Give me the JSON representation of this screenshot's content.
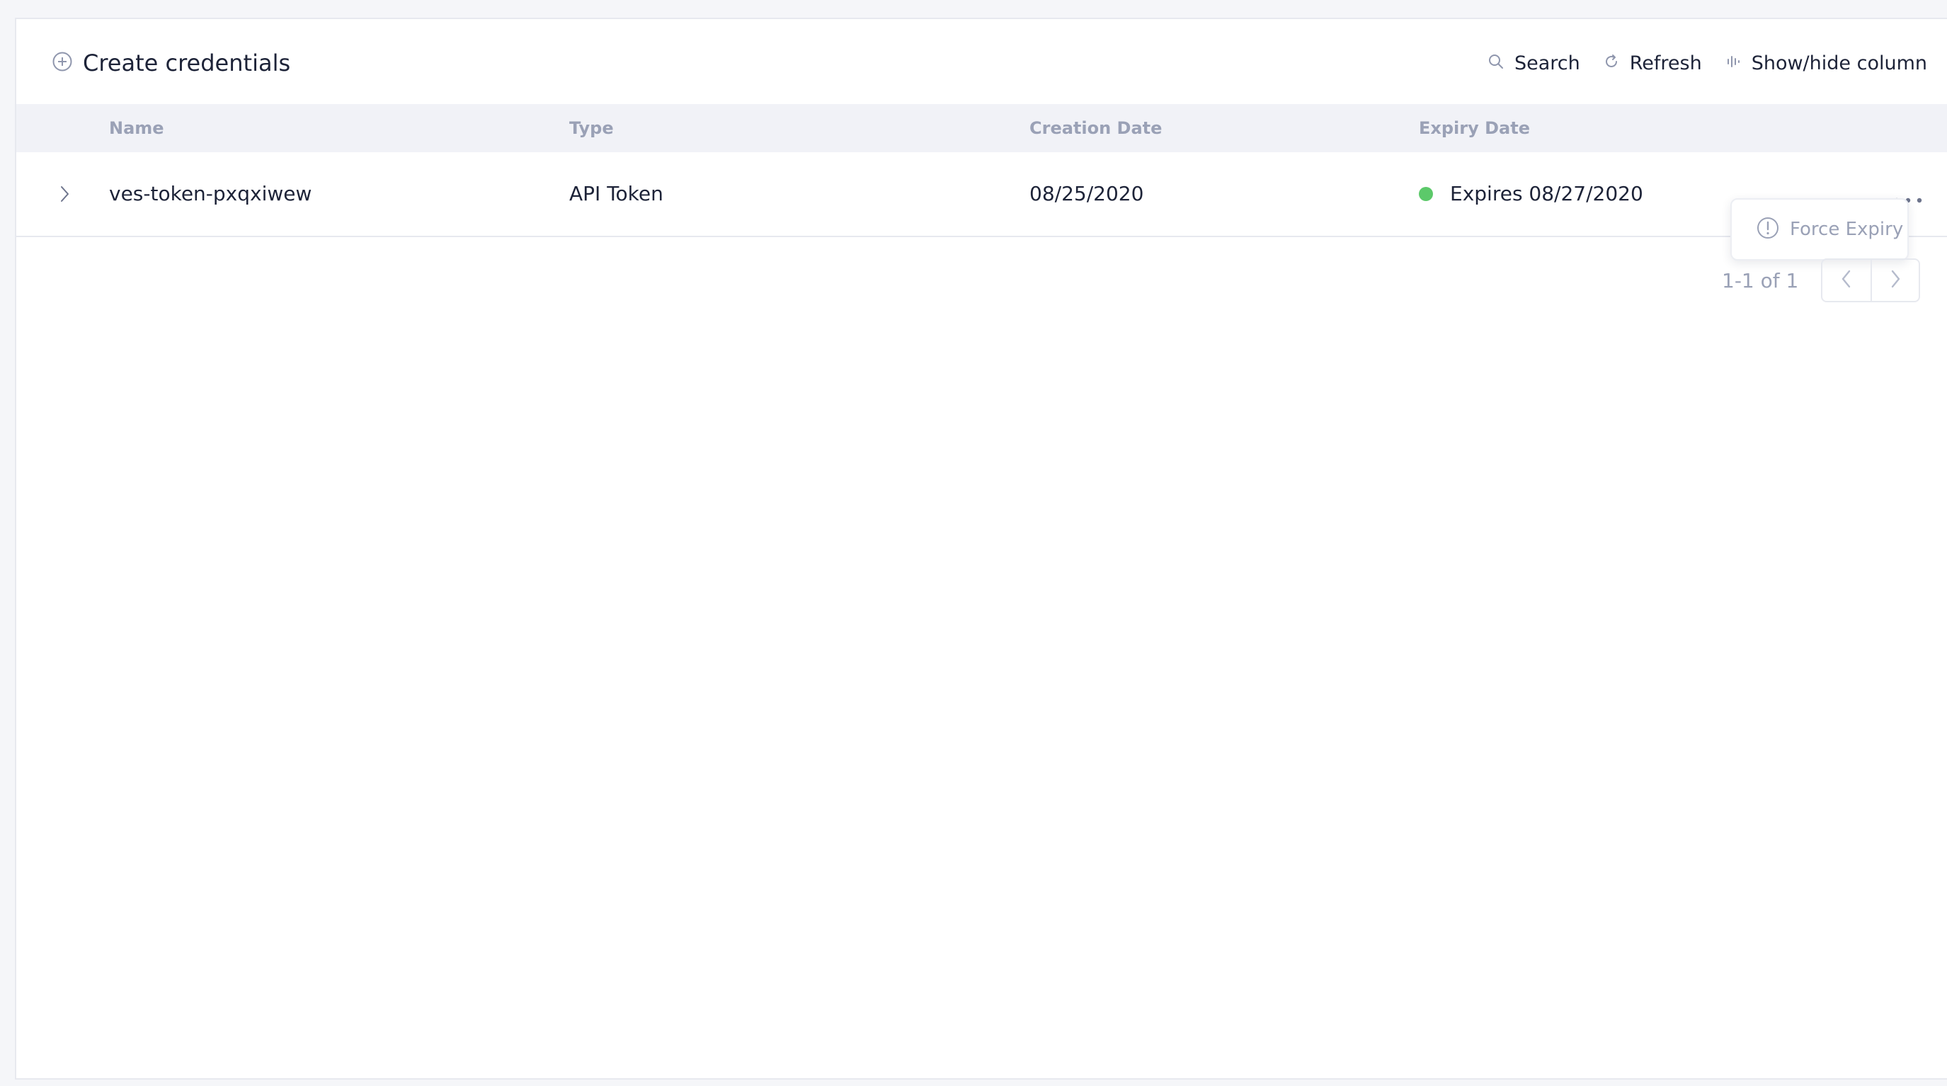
{
  "toolbar": {
    "create_label": "Create credentials",
    "search_label": "Search",
    "refresh_label": "Refresh",
    "columns_label": "Show/hide column"
  },
  "table": {
    "columns": [
      "Name",
      "Type",
      "Creation Date",
      "Expiry Date"
    ],
    "rows": [
      {
        "name": "ves-token-pxqxiwew",
        "type": "API Token",
        "creation_date": "08/25/2020",
        "expiry": "Expires 08/27/2020",
        "status_color": "#5cc96a"
      }
    ]
  },
  "row_menu": {
    "items": [
      {
        "label": "Force Expiry",
        "icon": "alert-circle-icon"
      }
    ]
  },
  "pagination": {
    "info": "1-1 of 1"
  },
  "colors": {
    "text": "#1d2338",
    "muted": "#9aa1b6",
    "header_bg": "#f1f2f7",
    "status_ok": "#5cc96a"
  }
}
